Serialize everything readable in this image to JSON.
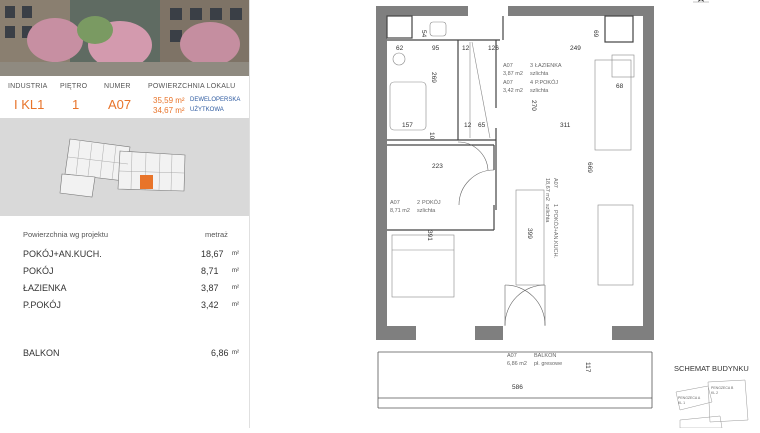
{
  "header": {
    "col_industria": "INDUSTRIA",
    "col_pietro": "PIĘTRO",
    "col_numer": "NUMER",
    "col_powierzchnia": "POWIERZCHNIA LOKALU",
    "industria": "I KL1",
    "pietro": "1",
    "numer": "A07",
    "area_dev": "35,59 m²",
    "area_dev_tag": "DEWELOPERSKA",
    "area_use": "34,67 m²",
    "area_use_tag": "UŻYTKOWA"
  },
  "table": {
    "head_left": "Powierzchnia wg projektu",
    "head_right": "metraż",
    "rows": [
      {
        "name": "POKÓJ+AN.KUCH.",
        "value": "18,67",
        "unit": "m²"
      },
      {
        "name": "POKÓJ",
        "value": "8,71",
        "unit": "m²"
      },
      {
        "name": "ŁAZIENKA",
        "value": "3,87",
        "unit": "m²"
      },
      {
        "name": "P.POKÓJ",
        "value": "3,42",
        "unit": "m²"
      }
    ],
    "balkon": {
      "name": "BALKON",
      "value": "6,86",
      "unit": "m²"
    }
  },
  "plan": {
    "dims": {
      "d54": "54",
      "d62": "62",
      "d95": "95",
      "d12a": "12",
      "d126": "126",
      "d249": "249",
      "d69": "69",
      "d269": "269",
      "d68": "68",
      "d157": "157",
      "d10": "10",
      "d12b": "12",
      "d65": "65",
      "d311": "311",
      "d270": "270",
      "d669": "669",
      "d223": "223",
      "d391": "391",
      "d399": "399",
      "d586": "586",
      "d117": "117"
    },
    "rooms": {
      "bath_code": "A07",
      "bath_num": "3",
      "bath_name": "ŁAZIENKA",
      "bath_area": "3,87 m2",
      "bath_floor": "szlichta",
      "hall_code": "A07",
      "hall_num": "4",
      "hall_name": "P.POKÓJ",
      "hall_area": "3,42 m2",
      "hall_floor": "szlichta",
      "room2_code": "A07",
      "room2_num": "2",
      "room2_name": "POKÓJ",
      "room2_area": "8,71 m2",
      "room2_floor": "szlichta",
      "room1_code": "A07",
      "room1_num": "1",
      "room1_name": "POKÓJ+AN.KUCH.",
      "room1_area": "18,67 m2",
      "room1_floor": "szlichta",
      "balkon_code": "A07",
      "balkon_name": "BALKON",
      "balkon_area": "6,86 m2",
      "balkon_floor": "pł. gresowe"
    }
  },
  "schema": {
    "title": "SCHEMAT BUDYNKU",
    "label_a": "PENGZECA A",
    "label_a2": "KL 1",
    "label_b": "PENGZECA B",
    "label_b2": "KL 2"
  },
  "colors": {
    "accent": "#e8742a",
    "blue_tag": "#2d5aa0",
    "wall": "#7f7f7f"
  }
}
